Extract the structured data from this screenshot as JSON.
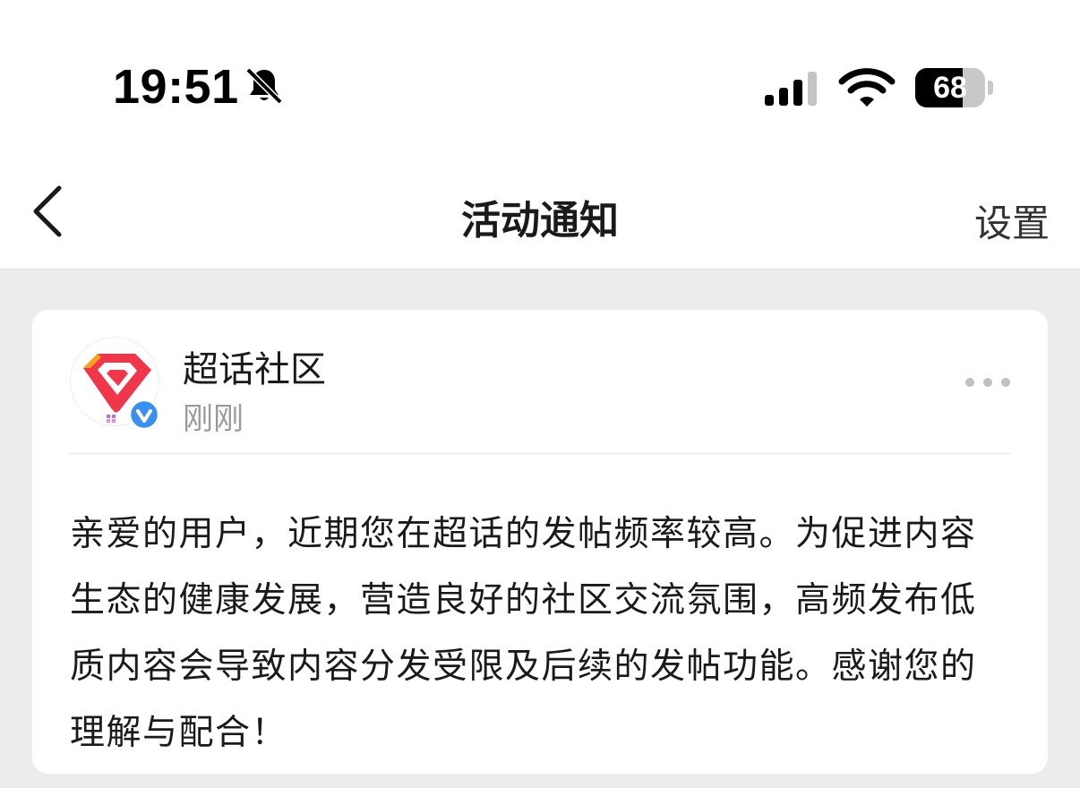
{
  "status_bar": {
    "time": "19:51",
    "battery": "68",
    "battery_level": 0.68,
    "icons": [
      "bell-slash-icon",
      "cellular-signal-icon",
      "wifi-icon",
      "battery-icon"
    ]
  },
  "nav": {
    "title": "活动通知",
    "settings_label": "设置",
    "back_icon": "chevron-left-icon"
  },
  "notification": {
    "sender": "超话社区",
    "time": "刚刚",
    "verified_icon": "verified-v-icon",
    "more_icon": "more-dots-icon",
    "message": "亲爱的用户，近期您在超话的发帖频率较高。为促进内容生态的健康发展，营造良好的社区交流氛围，高频发布低质内容会导致内容分发受限及后续的发帖功能。感谢您的理解与配合！"
  },
  "colors": {
    "background": "#ececec",
    "card": "#ffffff",
    "logo_red": "#f0364a",
    "logo_orange": "#f8a01c",
    "verified_blue": "#3b8ff0",
    "muted_text": "#9a9a9a"
  }
}
